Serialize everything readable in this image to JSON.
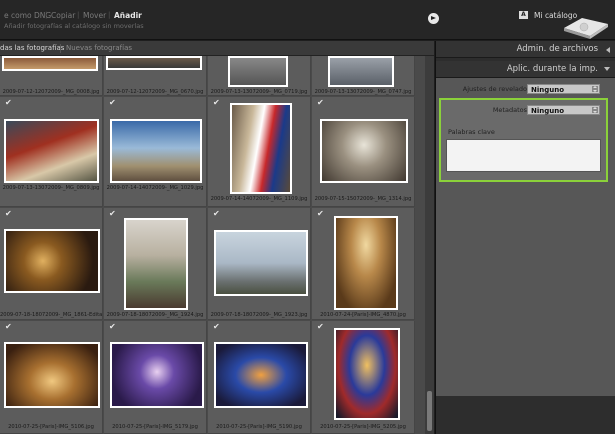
{
  "top_bar": {
    "modes": [
      "e como DNG",
      "Copiar",
      "Mover",
      "Añadir"
    ],
    "active_mode": "Añadir",
    "subtitle": "Añadir fotografías al catálogo sin moverlas",
    "catalog_badge": "A",
    "catalog_label": "Mi catálogo"
  },
  "tabs": [
    "das las fotografías",
    "Nuevas fotografías"
  ],
  "grid": {
    "top_row_files": [
      "2009-07-12-12072009-_MG_0008.jpg",
      "2009-07-12-12072009-_MG_0670.jpg",
      "2009-07-13-13072009-_MG_0719.jpg",
      "2009-07-13-13072009-_MG_0747.jpg"
    ],
    "rows": [
      [
        "2009-07-13-13072009-_MG_0809.jpg",
        "2009-07-14-14072009-_MG_1029.jpg",
        "2009-07-14-14072009-_MG_1109.jpg",
        "2009-07-15-15072009-_MG_1314.jpg"
      ],
      [
        "2009-07-18-18072009-_MG_1861-Editar...",
        "2009-07-18-18072009-_MG_1924.jpg",
        "2009-07-18-18072009-_MG_1923.jpg",
        "2010-07-24-[Paris]-IMG_4870.jpg"
      ],
      [
        "2010-07-25-[Paris]-IMG_5106.jpg",
        "2010-07-25-[Paris]-IMG_5179.jpg",
        "2010-07-25-[Paris]-IMG_5190.jpg",
        "2010-07-25-[Paris]-IMG_5205.jpg"
      ]
    ]
  },
  "right_panel": {
    "section1": "Admin. de archivos",
    "section2": "Aplic. durante la imp.",
    "develop_label": "Ajustes de revelado",
    "develop_value": "Ninguno",
    "metadata_label": "Metadatos",
    "metadata_value": "Ninguno",
    "keywords_label": "Palabras clave",
    "keywords_value": ""
  },
  "colors": {
    "highlight": "#8bd13a"
  }
}
